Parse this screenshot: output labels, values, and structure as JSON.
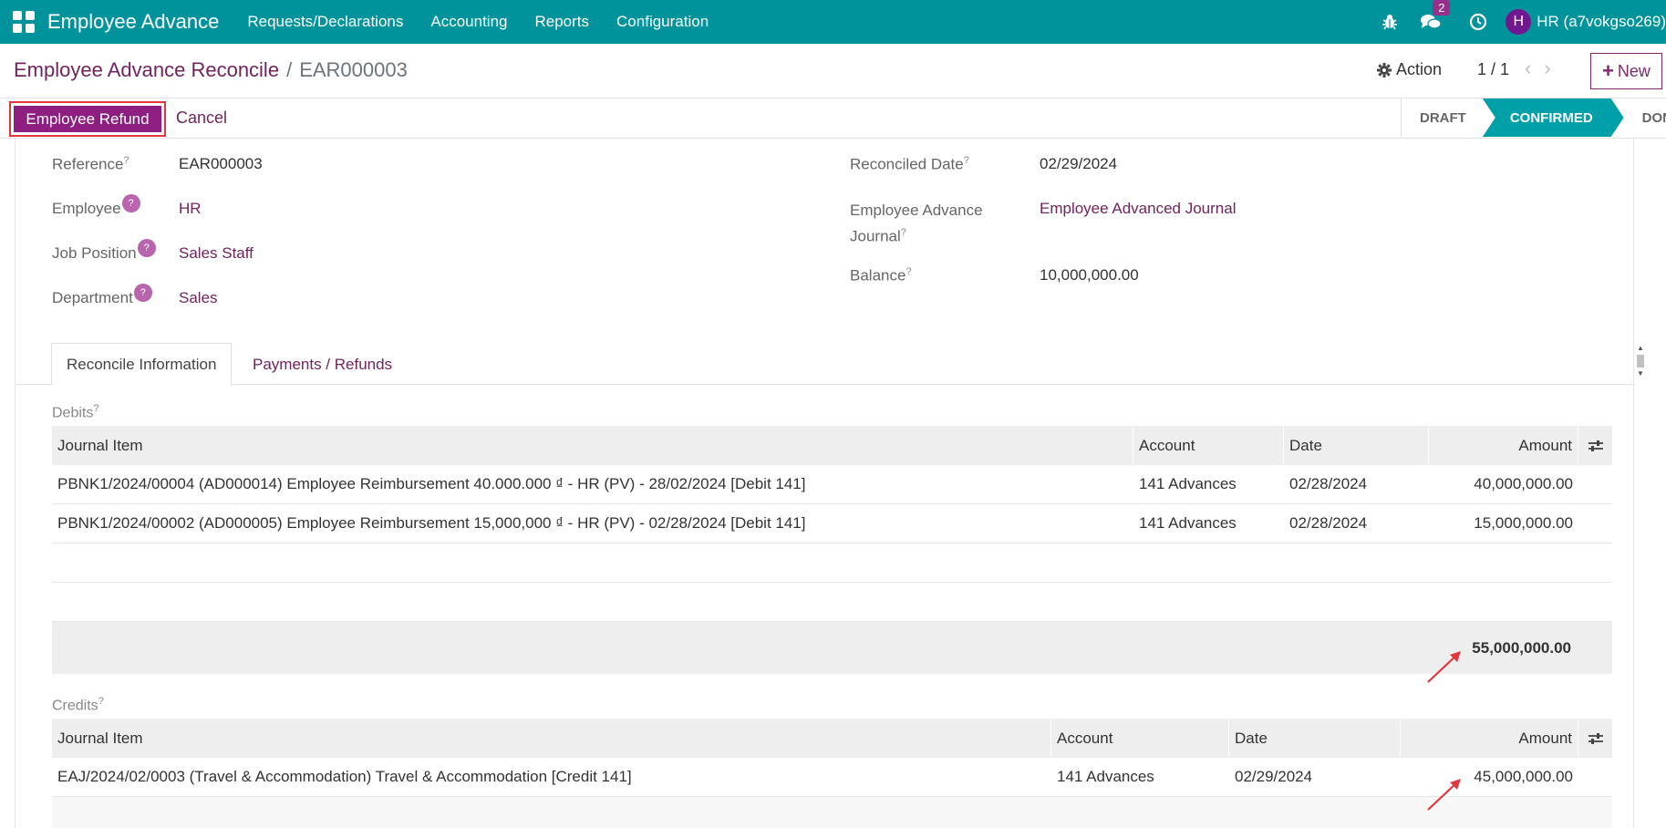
{
  "navbar": {
    "brand": "Employee Advance",
    "menu": [
      "Requests/Declarations",
      "Accounting",
      "Reports",
      "Configuration"
    ],
    "message_count": "2",
    "avatar_letter": "H",
    "user": "HR (a7vokgso269)"
  },
  "control": {
    "breadcrumb_parent": "Employee Advance Reconcile",
    "breadcrumb_separator": "/",
    "breadcrumb_current": "EAR000003",
    "action_label": "Action",
    "pager": "1 / 1",
    "new_label": "New"
  },
  "statusbar": {
    "refund_label": "Employee Refund",
    "cancel_label": "Cancel",
    "stages": [
      "DRAFT",
      "CONFIRMED",
      "DONE"
    ],
    "active_stage": "CONFIRMED"
  },
  "form": {
    "reference_label": "Reference",
    "reference": "EAR000003",
    "employee_label": "Employee",
    "employee": "HR",
    "job_label": "Job Position",
    "job": "Sales Staff",
    "department_label": "Department",
    "department": "Sales",
    "reconciled_date_label": "Reconciled Date",
    "reconciled_date": "02/29/2024",
    "journal_label_1": "Employee Advance",
    "journal_label_2": "Journal",
    "journal": "Employee Advanced Journal",
    "balance_label": "Balance",
    "balance": "10,000,000.00",
    "help_mark": "?"
  },
  "tabs": [
    "Reconcile Information",
    "Payments / Refunds"
  ],
  "debits": {
    "label": "Debits",
    "columns": [
      "Journal Item",
      "Account",
      "Date",
      "Amount"
    ],
    "rows": [
      {
        "item": "PBNK1/2024/00004 (AD000014) Employee Reimbursement 40.000.000 ₫ - HR (PV) - 28/02/2024 [Debit 141]",
        "account": "141 Advances",
        "date": "02/28/2024",
        "amount": "40,000,000.00"
      },
      {
        "item": "PBNK1/2024/00002 (AD000005) Employee Reimbursement 15,000,000 ₫ - HR (PV) - 02/28/2024 [Debit 141]",
        "account": "141 Advances",
        "date": "02/28/2024",
        "amount": "15,000,000.00"
      }
    ],
    "total": "55,000,000.00"
  },
  "credits": {
    "label": "Credits",
    "columns": [
      "Journal Item",
      "Account",
      "Date",
      "Amount"
    ],
    "rows": [
      {
        "item": "EAJ/2024/02/0003 (Travel & Accommodation) Travel & Accommodation [Credit 141]",
        "account": "141 Advances",
        "date": "02/29/2024",
        "amount": "45,000,000.00"
      }
    ]
  },
  "colors": {
    "navbar": "#00939c",
    "primary": "#8e1f80",
    "link": "#71245e",
    "stage_active": "#00a0a8",
    "annotation": "#e0383e"
  }
}
